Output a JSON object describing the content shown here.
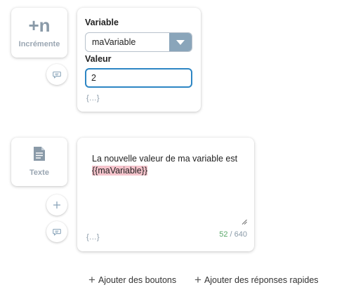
{
  "increment_block": {
    "icon_text": "+n",
    "label": "Incrémente"
  },
  "increment_editor": {
    "variable_label": "Variable",
    "variable_value": "maVariable",
    "value_label": "Valeur",
    "value_input": "2",
    "vars_link": "{...}"
  },
  "text_block": {
    "label": "Texte"
  },
  "text_editor": {
    "line1": "La nouvelle valeur de ma variable est",
    "variable_token": "{{maVariable}}",
    "vars_link": "{...}",
    "count_current": "52",
    "count_sep": " / ",
    "count_max": "640"
  },
  "actions": {
    "add_buttons": "Ajouter des boutons",
    "add_quick_replies": "Ajouter des réponses rapides"
  },
  "colors": {
    "accent_blue": "#2d86c4",
    "select_arrow_bg": "#8aa5ba",
    "highlight_pink": "#f5c4cc",
    "counter_green": "#5aa86a",
    "muted_text": "#8a9aa8"
  }
}
